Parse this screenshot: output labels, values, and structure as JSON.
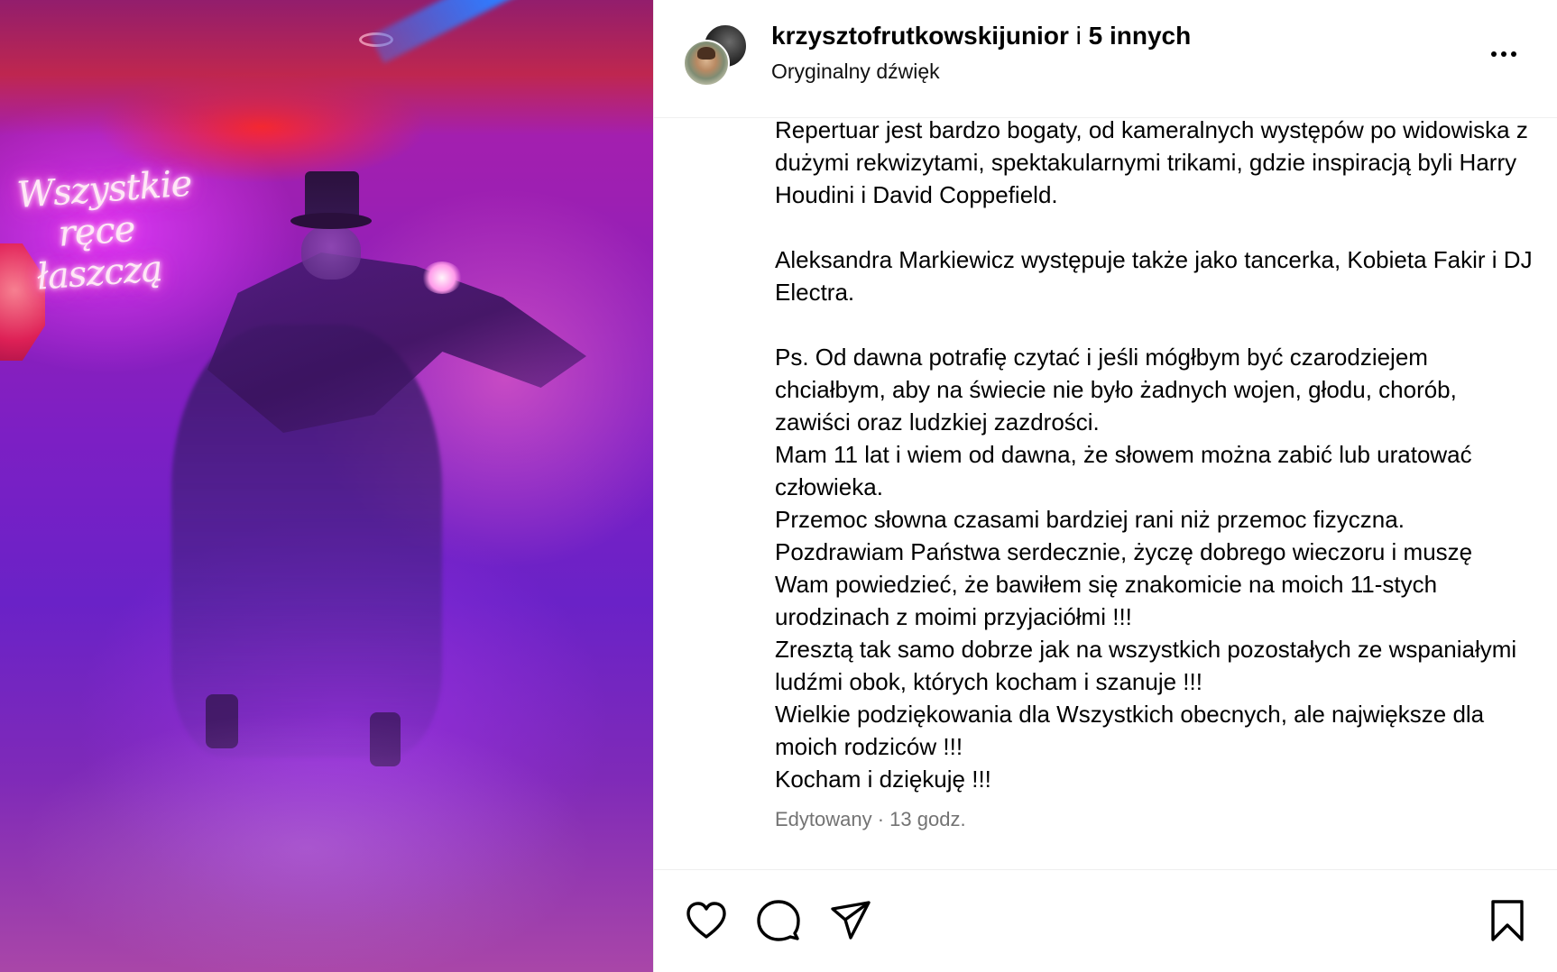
{
  "media": {
    "neon_sign_text": [
      "Wszystkie",
      "ręce",
      "łaszczą"
    ]
  },
  "header": {
    "username": "krzysztofrutkowskijunior",
    "connector": "i",
    "others": "5 innych",
    "audio": "Oryginalny dźwięk",
    "more_icon": "more-horizontal-icon"
  },
  "caption": {
    "paragraphs": [
      "Repertuar jest bardzo bogaty, od kameralnych występów po widowiska z dużymi rekwizytami, spektakularnymi trikami, gdzie inspiracją byli Harry Houdini i David Coppefield.",
      "Aleksandra Markiewicz występuje także jako tancerka, Kobieta Fakir i DJ Electra.",
      "Ps. Od dawna potrafię czytać i jeśli mógłbym być czarodziejem chciałbym, aby na świecie nie było żadnych wojen, głodu, chorób, zawiści oraz ludzkiej zazdrości.\nMam 11 lat i wiem od dawna, że słowem można zabić lub uratować człowieka.\nPrzemoc słowna czasami bardziej rani niż przemoc fizyczna.\nPozdrawiam Państwa serdecznie, życzę dobrego wieczoru i muszę Wam powiedzieć, że bawiłem się znakomicie na moich 11-stych urodzinach z moimi przyjaciółmi !!!\nZresztą tak samo dobrze jak na wszystkich pozostałych ze wspaniałymi ludźmi obok, których kocham i szanuje !!!\nWielkie podziękowania dla Wszystkich obecnych, ale największe dla moich rodziców !!!\nKocham i dziękuję !!!"
    ],
    "timestamp": "Edytowany · 13 godz."
  },
  "actions": {
    "like_icon": "heart-icon",
    "comment_icon": "comment-icon",
    "share_icon": "send-icon",
    "save_icon": "bookmark-icon"
  },
  "colors": {
    "text": "#000000",
    "secondary_text": "#737373",
    "divider": "#efefef"
  }
}
